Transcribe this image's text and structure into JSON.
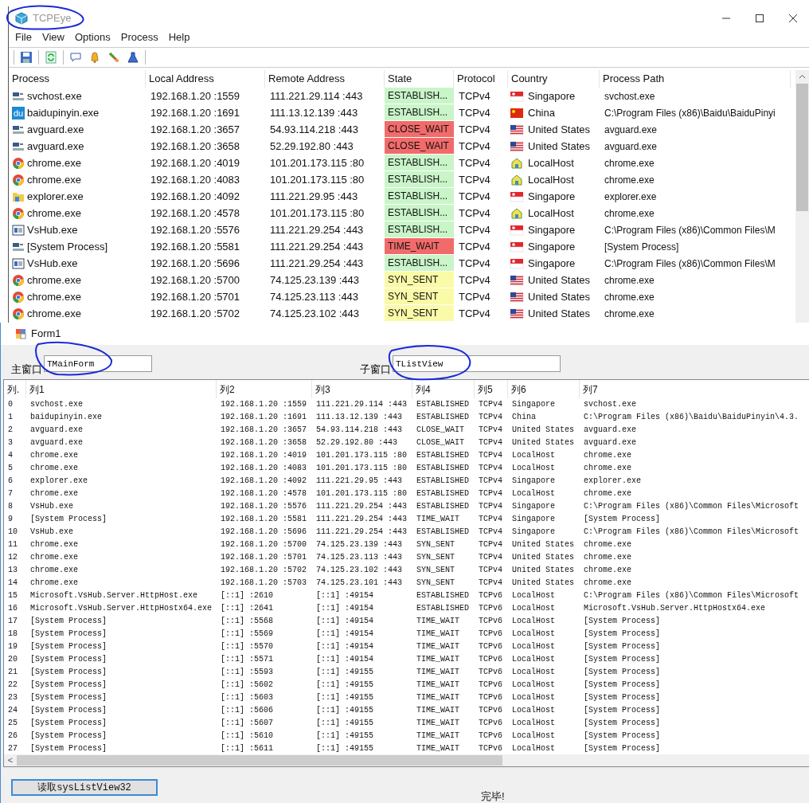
{
  "main_window": {
    "title": "TCPEye",
    "menu": [
      "File",
      "View",
      "Options",
      "Process",
      "Help"
    ],
    "table": {
      "columns": [
        "Process",
        "Local Address",
        "Remote Address",
        "State",
        "Protocol",
        "Country",
        "Process Path"
      ],
      "rows": [
        {
          "process": {
            "kind": "service",
            "name": "svchost.exe"
          },
          "local": "192.168.1.20 :1559",
          "remote": "111.221.29.114 :443",
          "state": "ESTABLISH...",
          "color": "#c9f5c9",
          "protocol": "TCPv4",
          "country": {
            "kind": "sg",
            "name": "Singapore"
          },
          "path": "svchost.exe"
        },
        {
          "process": {
            "kind": "du",
            "icon_text": "du",
            "name": "baidupinyin.exe"
          },
          "local": "192.168.1.20 :1691",
          "remote": "111.13.12.139 :443",
          "state": "ESTABLISH...",
          "color": "#c9f5c9",
          "protocol": "TCPv4",
          "country": {
            "kind": "cn",
            "name": "China"
          },
          "path": "C:\\Program Files (x86)\\Baidu\\BaiduPinyi"
        },
        {
          "process": {
            "kind": "service",
            "name": "avguard.exe"
          },
          "local": "192.168.1.20 :3657",
          "remote": "54.93.114.218 :443",
          "state": "CLOSE_WAIT",
          "color": "#f26b6b",
          "protocol": "TCPv4",
          "country": {
            "kind": "us",
            "name": "United States"
          },
          "path": "avguard.exe"
        },
        {
          "process": {
            "kind": "service",
            "name": "avguard.exe"
          },
          "local": "192.168.1.20 :3658",
          "remote": "52.29.192.80 :443",
          "state": "CLOSE_WAIT",
          "color": "#f26b6b",
          "protocol": "TCPv4",
          "country": {
            "kind": "us",
            "name": "United States"
          },
          "path": "avguard.exe"
        },
        {
          "process": {
            "kind": "chrome",
            "name": "chrome.exe"
          },
          "local": "192.168.1.20 :4019",
          "remote": "101.201.173.115 :80",
          "state": "ESTABLISH...",
          "color": "#c9f5c9",
          "protocol": "TCPv4",
          "country": {
            "kind": "local",
            "name": "LocalHost"
          },
          "path": "chrome.exe"
        },
        {
          "process": {
            "kind": "chrome",
            "name": "chrome.exe"
          },
          "local": "192.168.1.20 :4083",
          "remote": "101.201.173.115 :80",
          "state": "ESTABLISH...",
          "color": "#c9f5c9",
          "protocol": "TCPv4",
          "country": {
            "kind": "local",
            "name": "LocalHost"
          },
          "path": "chrome.exe"
        },
        {
          "process": {
            "kind": "folder",
            "name": "explorer.exe"
          },
          "local": "192.168.1.20 :4092",
          "remote": "111.221.29.95 :443",
          "state": "ESTABLISH...",
          "color": "#c9f5c9",
          "protocol": "TCPv4",
          "country": {
            "kind": "sg",
            "name": "Singapore"
          },
          "path": "explorer.exe"
        },
        {
          "process": {
            "kind": "chrome",
            "name": "chrome.exe"
          },
          "local": "192.168.1.20 :4578",
          "remote": "101.201.173.115 :80",
          "state": "ESTABLISH...",
          "color": "#c9f5c9",
          "protocol": "TCPv4",
          "country": {
            "kind": "local",
            "name": "LocalHost"
          },
          "path": "chrome.exe"
        },
        {
          "process": {
            "kind": "window",
            "name": "VsHub.exe"
          },
          "local": "192.168.1.20 :5576",
          "remote": "111.221.29.254 :443",
          "state": "ESTABLISH...",
          "color": "#c9f5c9",
          "protocol": "TCPv4",
          "country": {
            "kind": "sg",
            "name": "Singapore"
          },
          "path": "C:\\Program Files (x86)\\Common Files\\M"
        },
        {
          "process": {
            "kind": "service",
            "name": "[System Process]"
          },
          "local": "192.168.1.20 :5581",
          "remote": "111.221.29.254 :443",
          "state": "TIME_WAIT",
          "color": "#f26b6b",
          "protocol": "TCPv4",
          "country": {
            "kind": "sg",
            "name": "Singapore"
          },
          "path": "[System Process]"
        },
        {
          "process": {
            "kind": "window",
            "name": "VsHub.exe"
          },
          "local": "192.168.1.20 :5696",
          "remote": "111.221.29.254 :443",
          "state": "ESTABLISH...",
          "color": "#c9f5c9",
          "protocol": "TCPv4",
          "country": {
            "kind": "sg",
            "name": "Singapore"
          },
          "path": "C:\\Program Files (x86)\\Common Files\\M"
        },
        {
          "process": {
            "kind": "chrome",
            "name": "chrome.exe"
          },
          "local": "192.168.1.20 :5700",
          "remote": "74.125.23.139 :443",
          "state": "SYN_SENT",
          "color": "#fafaa8",
          "protocol": "TCPv4",
          "country": {
            "kind": "us",
            "name": "United States"
          },
          "path": "chrome.exe"
        },
        {
          "process": {
            "kind": "chrome",
            "name": "chrome.exe"
          },
          "local": "192.168.1.20 :5701",
          "remote": "74.125.23.113 :443",
          "state": "SYN_SENT",
          "color": "#fafaa8",
          "protocol": "TCPv4",
          "country": {
            "kind": "us",
            "name": "United States"
          },
          "path": "chrome.exe"
        },
        {
          "process": {
            "kind": "chrome",
            "name": "chrome.exe"
          },
          "local": "192.168.1.20 :5702",
          "remote": "74.125.23.102 :443",
          "state": "SYN_SENT",
          "color": "#fafaa8",
          "protocol": "TCPv4",
          "country": {
            "kind": "us",
            "name": "United States"
          },
          "path": "chrome.exe"
        }
      ]
    }
  },
  "form_window": {
    "title": "Form1",
    "main_label": "主窗口",
    "main_value": "TMainForm",
    "child_label": "子窗口",
    "child_value": "TListView",
    "list": {
      "columns": [
        "列.",
        "列1",
        "列2",
        "列3",
        "列4",
        "列5",
        "列6",
        "列7"
      ],
      "rows": [
        [
          "0",
          "svchost.exe",
          "192.168.1.20 :1559",
          "111.221.29.114 :443",
          "ESTABLISHED",
          "TCPv4",
          "Singapore",
          "svchost.exe"
        ],
        [
          "1",
          "baidupinyin.exe",
          "192.168.1.20 :1691",
          "111.13.12.139 :443",
          "ESTABLISHED",
          "TCPv4",
          "China",
          "C:\\Program Files (x86)\\Baidu\\BaiduPinyin\\4.3."
        ],
        [
          "2",
          "avguard.exe",
          "192.168.1.20 :3657",
          "54.93.114.218 :443",
          "CLOSE_WAIT",
          "TCPv4",
          "United States",
          "avguard.exe"
        ],
        [
          "3",
          "avguard.exe",
          "192.168.1.20 :3658",
          "52.29.192.80 :443",
          "CLOSE_WAIT",
          "TCPv4",
          "United States",
          "avguard.exe"
        ],
        [
          "4",
          "chrome.exe",
          "192.168.1.20 :4019",
          "101.201.173.115 :80",
          "ESTABLISHED",
          "TCPv4",
          "LocalHost",
          "chrome.exe"
        ],
        [
          "5",
          "chrome.exe",
          "192.168.1.20 :4083",
          "101.201.173.115 :80",
          "ESTABLISHED",
          "TCPv4",
          "LocalHost",
          "chrome.exe"
        ],
        [
          "6",
          "explorer.exe",
          "192.168.1.20 :4092",
          "111.221.29.95 :443",
          "ESTABLISHED",
          "TCPv4",
          "Singapore",
          "explorer.exe"
        ],
        [
          "7",
          "chrome.exe",
          "192.168.1.20 :4578",
          "101.201.173.115 :80",
          "ESTABLISHED",
          "TCPv4",
          "LocalHost",
          "chrome.exe"
        ],
        [
          "8",
          "VsHub.exe",
          "192.168.1.20 :5576",
          "111.221.29.254 :443",
          "ESTABLISHED",
          "TCPv4",
          "Singapore",
          "C:\\Program Files (x86)\\Common Files\\Microsoft"
        ],
        [
          "9",
          "[System Process]",
          "192.168.1.20 :5581",
          "111.221.29.254 :443",
          "TIME_WAIT",
          "TCPv4",
          "Singapore",
          "[System Process]"
        ],
        [
          "10",
          "VsHub.exe",
          "192.168.1.20 :5696",
          "111.221.29.254 :443",
          "ESTABLISHED",
          "TCPv4",
          "Singapore",
          "C:\\Program Files (x86)\\Common Files\\Microsoft"
        ],
        [
          "11",
          "chrome.exe",
          "192.168.1.20 :5700",
          "74.125.23.139 :443",
          "SYN_SENT",
          "TCPv4",
          "United States",
          "chrome.exe"
        ],
        [
          "12",
          "chrome.exe",
          "192.168.1.20 :5701",
          "74.125.23.113 :443",
          "SYN_SENT",
          "TCPv4",
          "United States",
          "chrome.exe"
        ],
        [
          "13",
          "chrome.exe",
          "192.168.1.20 :5702",
          "74.125.23.102 :443",
          "SYN_SENT",
          "TCPv4",
          "United States",
          "chrome.exe"
        ],
        [
          "14",
          "chrome.exe",
          "192.168.1.20 :5703",
          "74.125.23.101 :443",
          "SYN_SENT",
          "TCPv4",
          "United States",
          "chrome.exe"
        ],
        [
          "15",
          "Microsoft.VsHub.Server.HttpHost.exe",
          "[::1] :2610",
          "[::1] :49154",
          "ESTABLISHED",
          "TCPv6",
          "LocalHost",
          "C:\\Program Files (x86)\\Common Files\\Microsoft"
        ],
        [
          "16",
          "Microsoft.VsHub.Server.HttpHostx64.exe",
          "[::1] :2641",
          "[::1] :49154",
          "ESTABLISHED",
          "TCPv6",
          "LocalHost",
          "Microsoft.VsHub.Server.HttpHostx64.exe"
        ],
        [
          "17",
          "[System Process]",
          "[::1] :5568",
          "[::1] :49154",
          "TIME_WAIT",
          "TCPv6",
          "LocalHost",
          "[System Process]"
        ],
        [
          "18",
          "[System Process]",
          "[::1] :5569",
          "[::1] :49154",
          "TIME_WAIT",
          "TCPv6",
          "LocalHost",
          "[System Process]"
        ],
        [
          "19",
          "[System Process]",
          "[::1] :5570",
          "[::1] :49154",
          "TIME_WAIT",
          "TCPv6",
          "LocalHost",
          "[System Process]"
        ],
        [
          "20",
          "[System Process]",
          "[::1] :5571",
          "[::1] :49154",
          "TIME_WAIT",
          "TCPv6",
          "LocalHost",
          "[System Process]"
        ],
        [
          "21",
          "[System Process]",
          "[::1] :5593",
          "[::1] :49155",
          "TIME_WAIT",
          "TCPv6",
          "LocalHost",
          "[System Process]"
        ],
        [
          "22",
          "[System Process]",
          "[::1] :5602",
          "[::1] :49155",
          "TIME_WAIT",
          "TCPv6",
          "LocalHost",
          "[System Process]"
        ],
        [
          "23",
          "[System Process]",
          "[::1] :5603",
          "[::1] :49155",
          "TIME_WAIT",
          "TCPv6",
          "LocalHost",
          "[System Process]"
        ],
        [
          "24",
          "[System Process]",
          "[::1] :5606",
          "[::1] :49155",
          "TIME_WAIT",
          "TCPv6",
          "LocalHost",
          "[System Process]"
        ],
        [
          "25",
          "[System Process]",
          "[::1] :5607",
          "[::1] :49155",
          "TIME_WAIT",
          "TCPv6",
          "LocalHost",
          "[System Process]"
        ],
        [
          "26",
          "[System Process]",
          "[::1] :5610",
          "[::1] :49155",
          "TIME_WAIT",
          "TCPv6",
          "LocalHost",
          "[System Process]"
        ],
        [
          "27",
          "[System Process]",
          "[::1] :5611",
          "[::1] :49155",
          "TIME_WAIT",
          "TCPv6",
          "LocalHost",
          "[System Process]"
        ]
      ]
    },
    "scroll_arrow": "<",
    "read_button": "读取sysListView32",
    "status": "完毕!"
  }
}
